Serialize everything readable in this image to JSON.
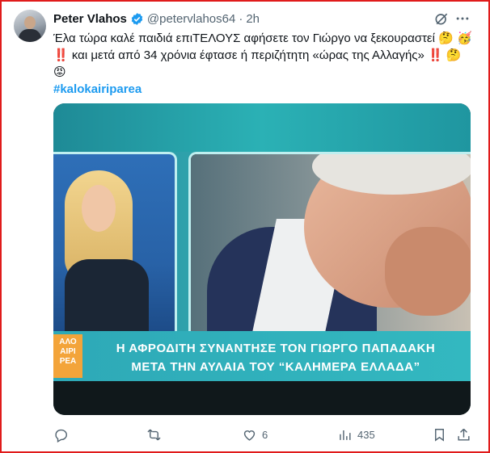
{
  "author": {
    "name": "Peter Vlahos",
    "handle": "@petervlahos64",
    "separator": "·",
    "time": "2h"
  },
  "icons": {
    "verified": "verified-badge-icon",
    "grok": "grok-icon",
    "more": "more-icon"
  },
  "tweet": {
    "line1": "Έλα τώρα καλέ παιδιά επιΤΕΛΟΥΣ αφήσετε τον Γιώργο να ξεκουραστεί 🤔 🥳",
    "line2": "‼️ και μετά από 34 χρόνια έφτασε ή περιζήτητη «ώρας της Αλλαγής» ‼️ 🤔",
    "line3": "😡",
    "hashtag": "#kalokairiparea"
  },
  "media": {
    "logo_lines": [
      "ΑΛΟ",
      "ΑΙΡΙ",
      "ΡΕΑ"
    ],
    "caption_line1": "Η ΑΦΡΟΔΙΤΗ ΣΥΝΑΝΤΗΣΕ ΤΟΝ ΓΙΩΡΓΟ ΠΑΠΑΔΑΚΗ",
    "caption_line2": "ΜΕΤΑ ΤΗΝ ΑΥΛΑΙΑ ΤΟΥ “ΚΑΛΗΜΕΡΑ ΕΛΛΑΔΑ”"
  },
  "actions": {
    "reply_count": "",
    "retweet_count": "",
    "like_count": "6",
    "views_count": "435"
  },
  "colors": {
    "accent": "#1d9bf0",
    "border": "#e01b1b",
    "muted": "#536471"
  }
}
